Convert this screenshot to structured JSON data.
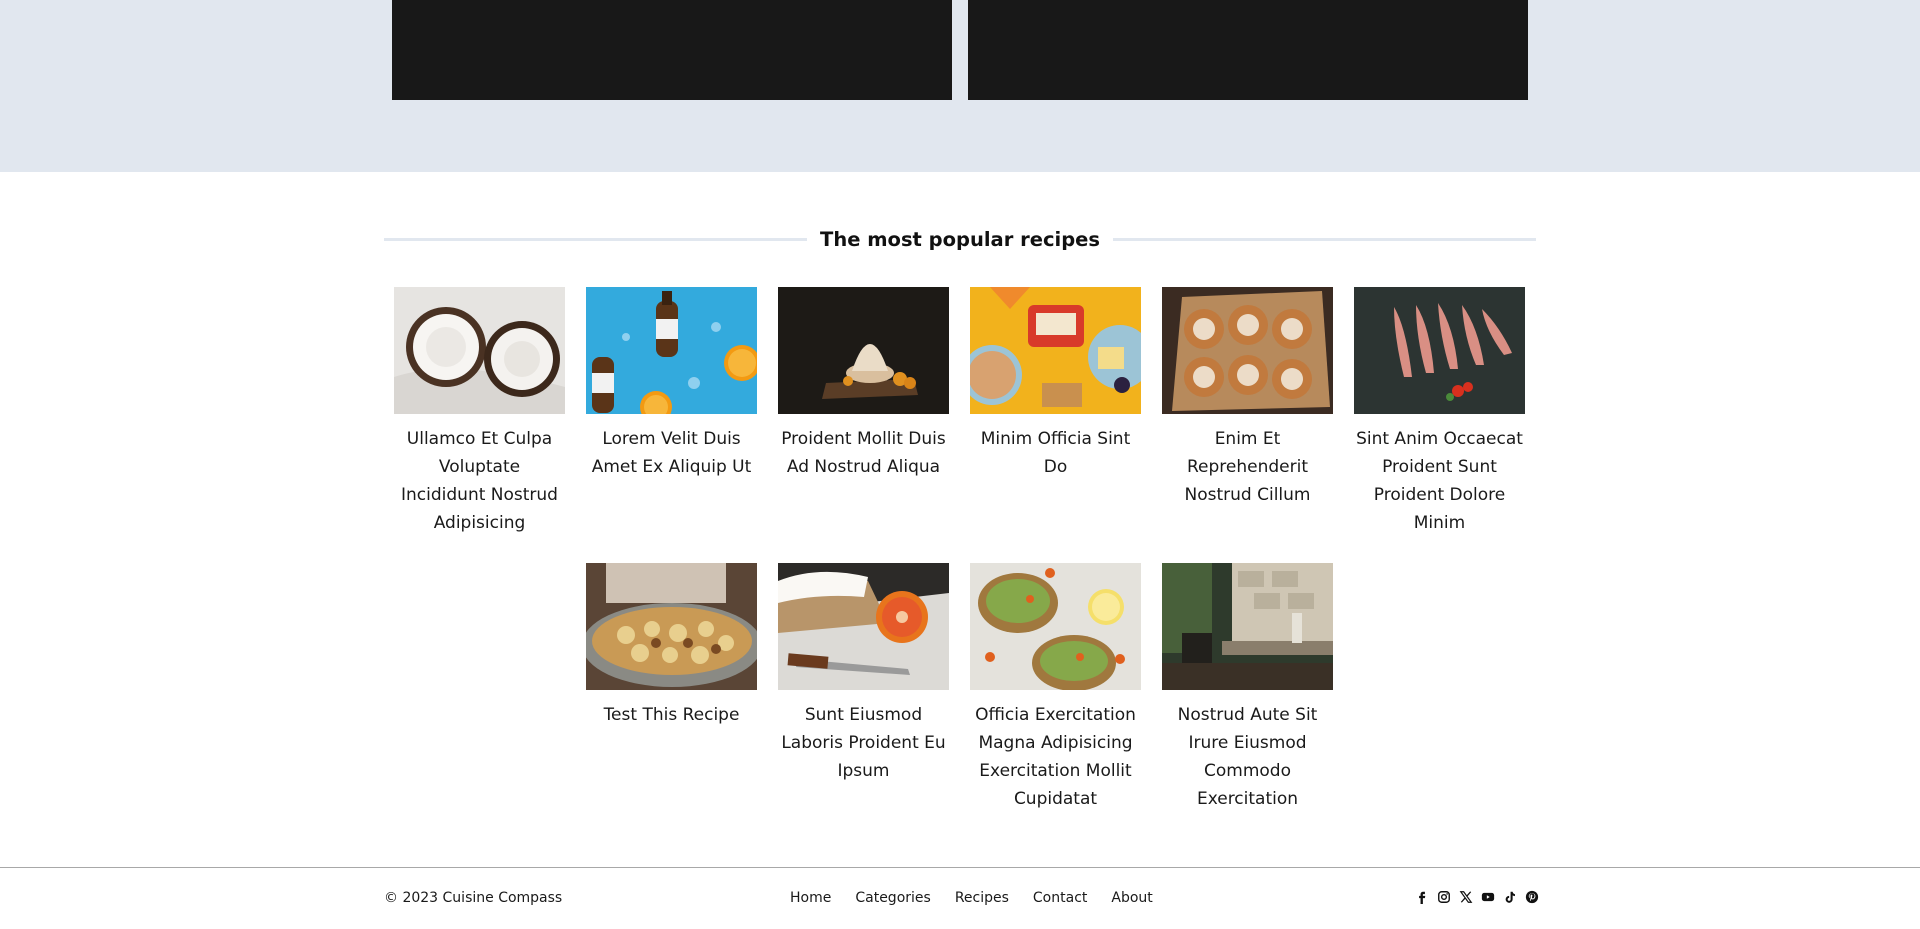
{
  "section": {
    "title": "The most popular recipes"
  },
  "recipes": [
    {
      "title": "Ullamco Et Culpa Voluptate Incididunt Nostrud Adipisicing",
      "image": "coconut"
    },
    {
      "title": "Lorem Velit Duis Amet Ex Aliquip Ut",
      "image": "bottles-oranges"
    },
    {
      "title": "Proident Mollit Duis Ad Nostrud Aliqua",
      "image": "dessert-board"
    },
    {
      "title": "Minim Officia Sint Do",
      "image": "snack-spread"
    },
    {
      "title": "Enim Et Reprehenderit Nostrud Cillum",
      "image": "cinnamon-rolls"
    },
    {
      "title": "Sint Anim Occaecat Proident Sunt Proident Dolore Minim",
      "image": "fish-platter"
    },
    {
      "title": "Test This Recipe",
      "image": "pastry-tray"
    },
    {
      "title": "Sunt Eiusmod Laboris Proident Eu Ipsum",
      "image": "meringue-orange"
    },
    {
      "title": "Officia Exercitation Magna Adipisicing Exercitation Mollit Cupidatat",
      "image": "avocado-toast"
    },
    {
      "title": "Nostrud Aute Sit Irure Eiusmod Commodo Exercitation",
      "image": "restaurant-interior"
    }
  ],
  "footer": {
    "copyright": "© 2023 Cuisine Compass",
    "nav": [
      "Home",
      "Categories",
      "Recipes",
      "Contact",
      "About"
    ],
    "socials": [
      "facebook-icon",
      "instagram-icon",
      "x-icon",
      "youtube-icon",
      "tiktok-icon",
      "pinterest-icon"
    ]
  },
  "colors": {
    "top_band": "#e1e7ef",
    "video": "#181818",
    "divider": "#e1e7ef"
  }
}
